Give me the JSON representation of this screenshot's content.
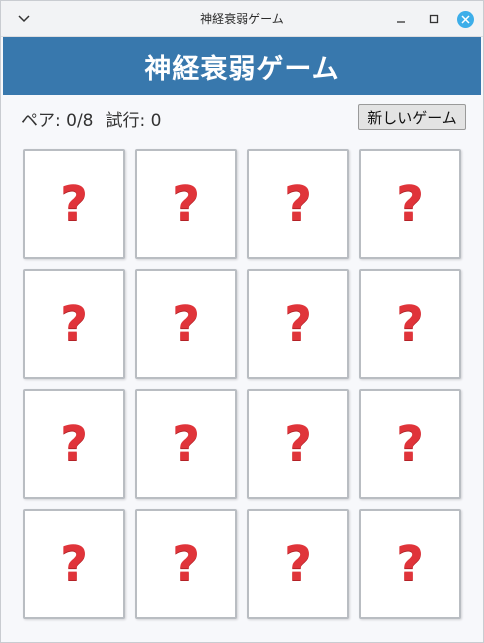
{
  "window": {
    "title": "神経衰弱ゲーム"
  },
  "header": {
    "title": "神経衰弱ゲーム",
    "color": "#3878ad"
  },
  "status": {
    "pairs_label": "ペア: 0/8",
    "tries_label": "試行: 0"
  },
  "new_game_button": "新しいゲーム",
  "board": {
    "rows": 4,
    "cols": 4,
    "card_face": "?",
    "card_icon": "question-mark-icon",
    "question_color": "#e0343a"
  }
}
